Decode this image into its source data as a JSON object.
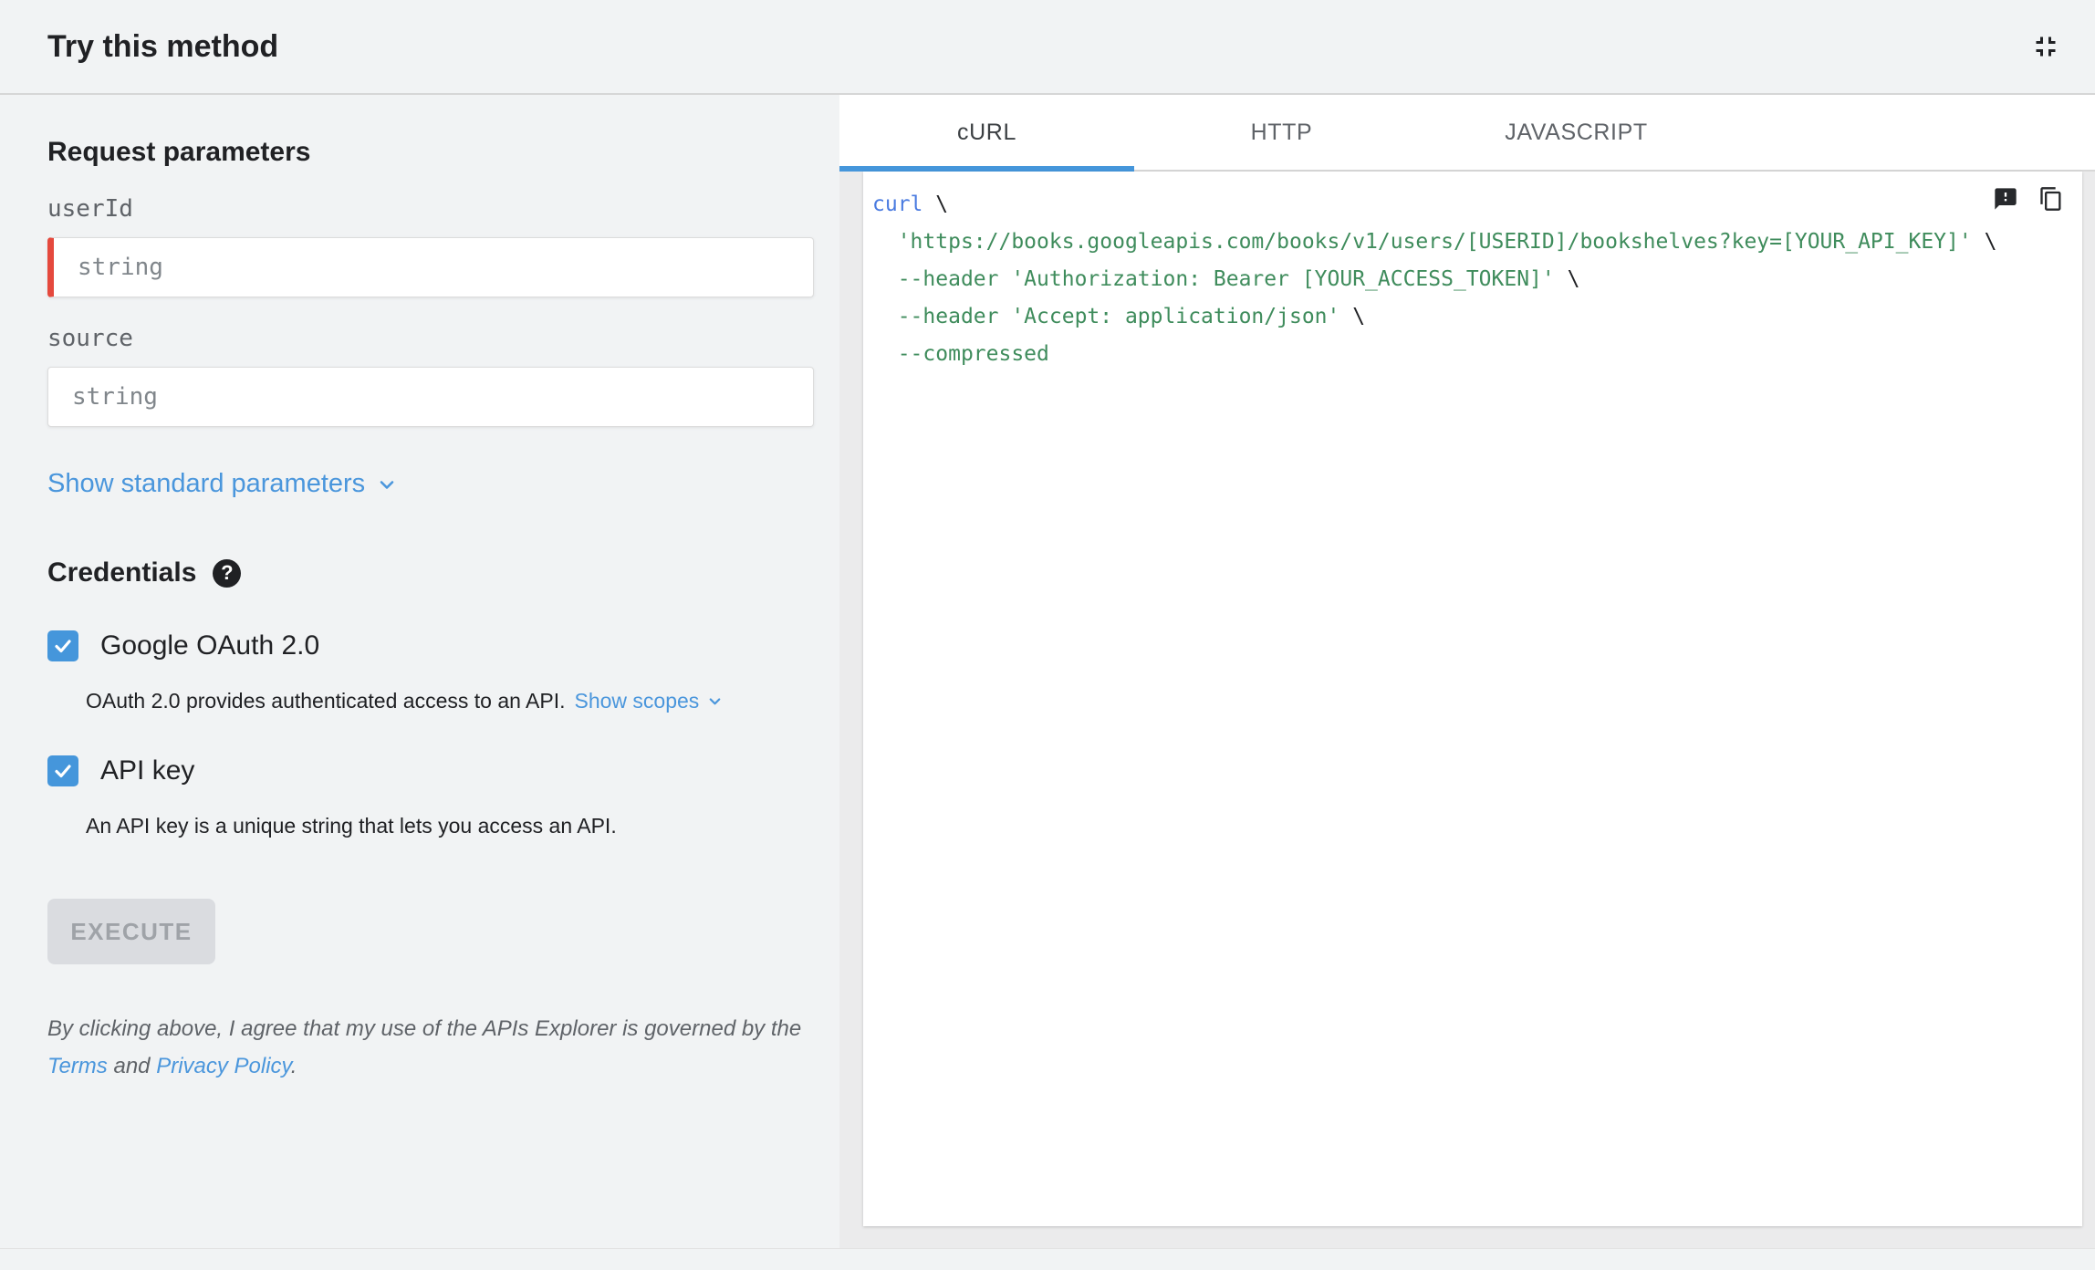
{
  "header": {
    "title": "Try this method"
  },
  "request_parameters": {
    "heading": "Request parameters",
    "fields": [
      {
        "label": "userId",
        "placeholder": "string",
        "value": "",
        "required": true
      },
      {
        "label": "source",
        "placeholder": "string",
        "value": "",
        "required": false
      }
    ],
    "show_standard_parameters_label": "Show standard parameters"
  },
  "credentials": {
    "heading": "Credentials",
    "options": [
      {
        "label": "Google OAuth 2.0",
        "checked": true,
        "description": "OAuth 2.0 provides authenticated access to an API.",
        "link_label": "Show scopes"
      },
      {
        "label": "API key",
        "checked": true,
        "description": "An API key is a unique string that lets you access an API."
      }
    ]
  },
  "execute_button": {
    "label": "EXECUTE",
    "disabled": true
  },
  "legal": {
    "text_before": "By clicking above, I agree that my use of the APIs Explorer is governed by the ",
    "terms_label": "Terms",
    "text_middle": " and ",
    "privacy_label": "Privacy Policy",
    "text_after": "."
  },
  "code_panel": {
    "tabs": [
      {
        "label": "cURL",
        "active": true
      },
      {
        "label": "HTTP",
        "active": false
      },
      {
        "label": "JAVASCRIPT",
        "active": false
      }
    ],
    "lines": [
      [
        {
          "t": "curl",
          "c": "kw"
        },
        {
          "t": " \\",
          "c": "pl"
        }
      ],
      [
        {
          "t": "  ",
          "c": "pl"
        },
        {
          "t": "'https://books.googleapis.com/books/v1/users/[USERID]/bookshelves?key=[YOUR_API_KEY]'",
          "c": "str"
        },
        {
          "t": " \\",
          "c": "pl"
        }
      ],
      [
        {
          "t": "  ",
          "c": "pl"
        },
        {
          "t": "--header 'Authorization: Bearer [YOUR_ACCESS_TOKEN]'",
          "c": "str"
        },
        {
          "t": " \\",
          "c": "pl"
        }
      ],
      [
        {
          "t": "  ",
          "c": "pl"
        },
        {
          "t": "--header 'Accept: application/json'",
          "c": "str"
        },
        {
          "t": " \\",
          "c": "pl"
        }
      ],
      [
        {
          "t": "  ",
          "c": "pl"
        },
        {
          "t": "--compressed",
          "c": "str"
        }
      ]
    ]
  },
  "colors": {
    "accent_blue": "#4596db",
    "link_blue": "#4a96dc",
    "required_red": "#e5493d",
    "code_keyword_blue": "#4a7be0",
    "code_string_green": "#3f8c5c",
    "page_background": "#f1f3f4",
    "disabled_button_bg": "#dadce0"
  }
}
